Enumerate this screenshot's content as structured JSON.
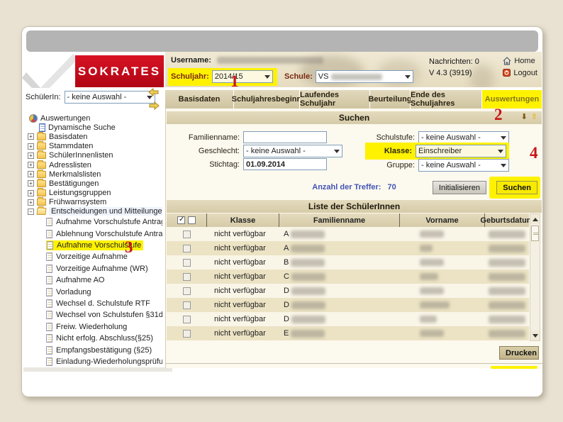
{
  "logo": {
    "text": "SOKRATES"
  },
  "topbar": {
    "username_label": "Username:",
    "schuljahr_label": "Schuljahr:",
    "schuljahr_value": "2014/15",
    "schule_label": "Schule:",
    "schule_value": "VS",
    "nachrichten": "Nachrichten: 0",
    "version": "V 4.3 (3919)",
    "home_label": "Home",
    "logout_label": "Logout"
  },
  "tabs": {
    "items": [
      {
        "label": "Basisdaten"
      },
      {
        "label": "Schuljahresbeginn"
      },
      {
        "label": "Laufendes Schuljahr"
      },
      {
        "label": "Beurteilung"
      },
      {
        "label": "Ende des Schuljahres"
      },
      {
        "label": "Auswertungen"
      }
    ]
  },
  "sidebar": {
    "schuelerin_label": "SchülerIn:",
    "schuelerin_value": "- keine Auswahl -",
    "tree": {
      "root": "Auswertungen",
      "search_item": "Dynamische Suche",
      "folders": [
        "Basisdaten",
        "Stammdaten",
        "SchülerInnenlisten",
        "Adresslisten",
        "Merkmalslisten",
        "Bestätigungen",
        "Leistungsgruppen",
        "Frühwarnsystem"
      ],
      "open_folder": "Entscheidungen und Mitteilungen",
      "children": [
        "Aufnahme Vorschulstufe Antrag",
        "Ablehnung Vorschulstufe Antrag",
        "Aufnahme Vorschulstufe",
        "Vorzeitige Aufnahme",
        "Vorzeitige Aufnahme (WR)",
        "Aufnahme AO",
        "Vorladung",
        "Wechsel d. Schulstufe RTF",
        "Wechsel von Schulstufen §31d",
        "Freiw. Wiederholung",
        "Nicht erfolg. Abschluss(§25)",
        "Empfangsbestätigung (§25)",
        "Einladung-Wiederholungsprüfung"
      ]
    }
  },
  "search": {
    "title": "Suchen",
    "familienname_label": "Familienname:",
    "familienname_value": "",
    "geschlecht_label": "Geschlecht:",
    "geschlecht_value": "- keine Auswahl -",
    "stichtag_label": "Stichtag:",
    "stichtag_value": "01.09.2014",
    "schulstufe_label": "Schulstufe:",
    "schulstufe_value": "- keine Auswahl -",
    "klasse_label": "Klasse:",
    "klasse_value": "Einschreiber",
    "gruppe_label": "Gruppe:",
    "gruppe_value": "- keine Auswahl -",
    "treffer_label": "Anzahl der Treffer:",
    "treffer_value": "70",
    "init_button": "Initialisieren",
    "suchen_button": "Suchen"
  },
  "table": {
    "title": "Liste der SchülerInnen",
    "columns": [
      "Klasse",
      "Familienname",
      "Vorname",
      "Geburtsdatum"
    ],
    "rows": [
      {
        "klasse": "nicht verfügbar",
        "initial": "A"
      },
      {
        "klasse": "nicht verfügbar",
        "initial": "A"
      },
      {
        "klasse": "nicht verfügbar",
        "initial": "B"
      },
      {
        "klasse": "nicht verfügbar",
        "initial": "C"
      },
      {
        "klasse": "nicht verfügbar",
        "initial": "D"
      },
      {
        "klasse": "nicht verfügbar",
        "initial": "D"
      },
      {
        "klasse": "nicht verfügbar",
        "initial": "D"
      },
      {
        "klasse": "nicht verfügbar",
        "initial": "E"
      }
    ]
  },
  "footer": {
    "drucken_button": "Drucken"
  },
  "annotations": {
    "n1": "1",
    "n2": "2",
    "n3": "3",
    "n4": "4"
  },
  "colors": {
    "highlight_yellow": "#fef200",
    "brand_red": "#c40a1e",
    "treffer_blue": "#4253b4"
  }
}
